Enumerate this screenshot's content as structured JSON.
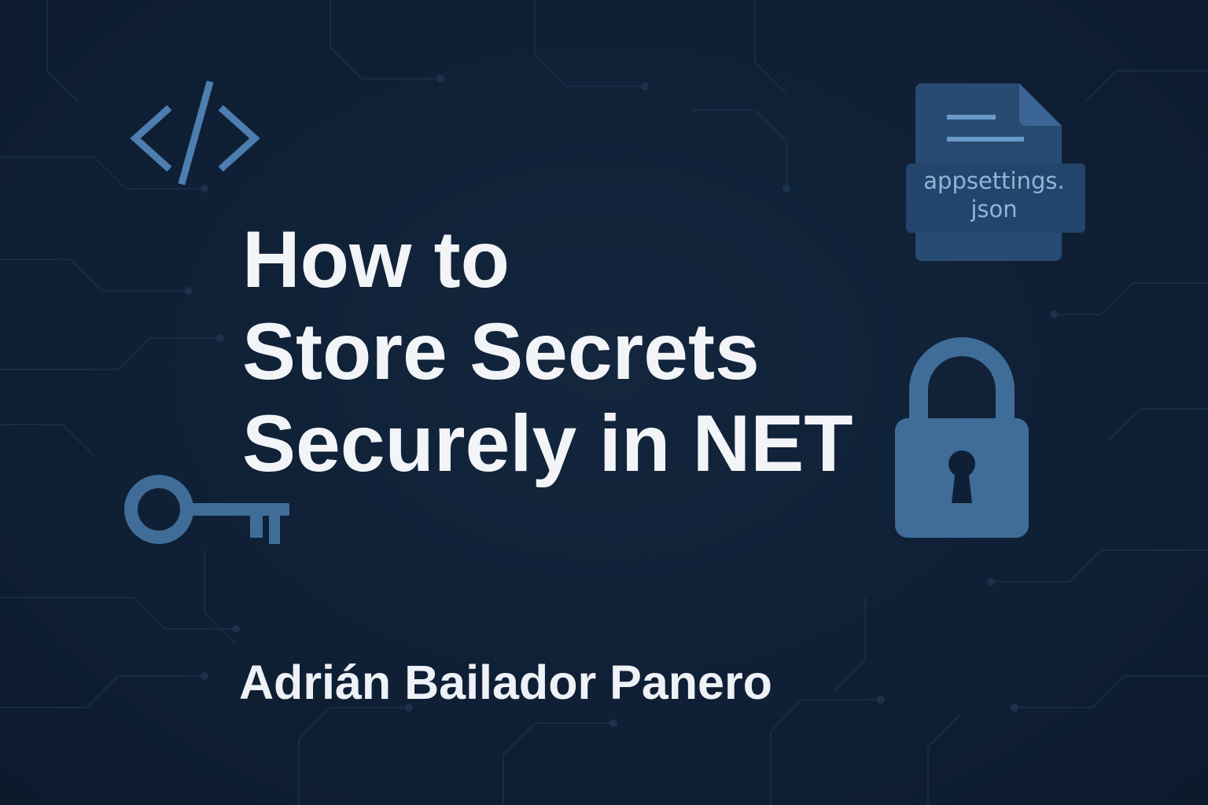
{
  "title_lines": [
    "How to",
    "Store Secrets",
    "Securely in NET"
  ],
  "author": "Adrián Bailador Panero",
  "file_label": [
    "appsettings.",
    "json"
  ],
  "icons": [
    "code-icon",
    "key-icon",
    "padlock-icon",
    "document-icon"
  ],
  "colors": {
    "background": "#0f1f33",
    "text": "#f2f4f7",
    "icon_accent": "#3f6d98",
    "icon_light": "#5d8fc0"
  }
}
